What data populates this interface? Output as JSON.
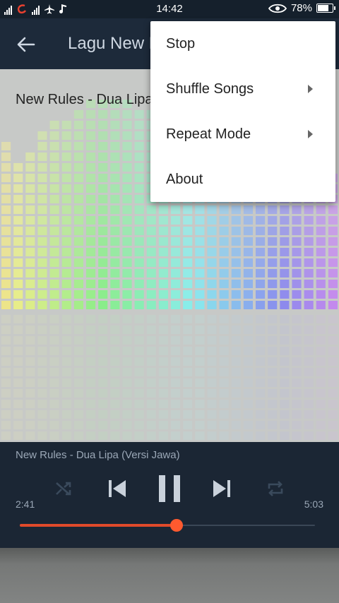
{
  "status_bar": {
    "time": "14:42",
    "battery": "78%",
    "battery_level": 0.78
  },
  "app_bar": {
    "title": "Lagu New Rules"
  },
  "song_overlay": "New Rules - Dua Lipa",
  "player": {
    "track": "New Rules - Dua Lipa (Versi Jawa)",
    "elapsed": "2:41",
    "duration": "5:03",
    "progress": 0.53
  },
  "menu": {
    "items": [
      {
        "label": "Stop",
        "submenu": false
      },
      {
        "label": "Shuffle Songs",
        "submenu": true
      },
      {
        "label": "Repeat Mode",
        "submenu": true
      },
      {
        "label": "About",
        "submenu": false
      }
    ]
  },
  "colors": {
    "accent": "#ff5a2f",
    "appbar": "#1d2a3a",
    "player_bg": "#1b2634"
  }
}
